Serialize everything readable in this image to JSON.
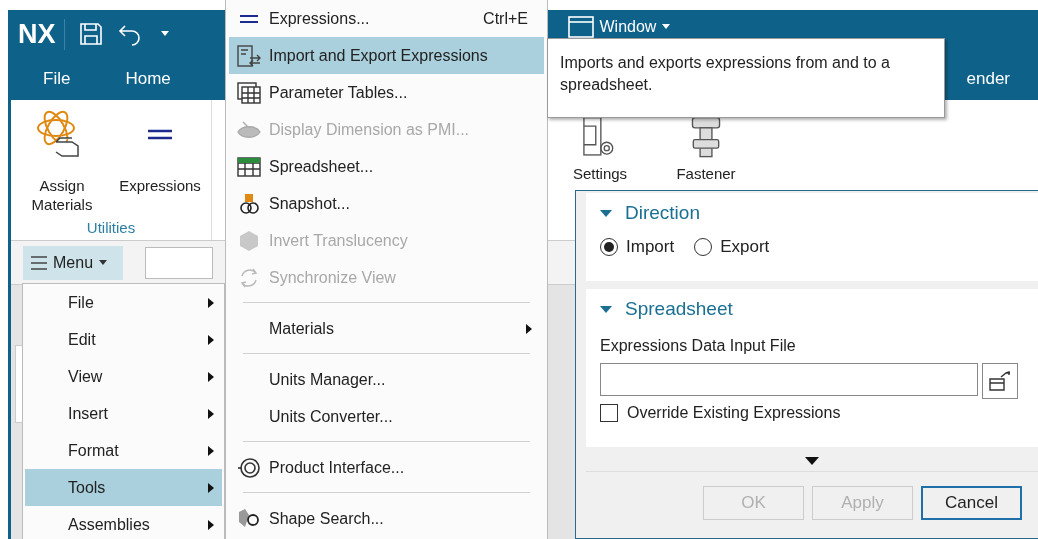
{
  "app": {
    "logo": "NX",
    "window_menu": "Window",
    "tabs": [
      {
        "label": "File"
      },
      {
        "label": "Home"
      },
      {
        "label": "ender"
      }
    ],
    "ribbon": {
      "commands": [
        {
          "label": "Assign Materials",
          "kind": "atom"
        },
        {
          "label": "Expressions",
          "kind": "equals"
        },
        {
          "label": "Settings",
          "kind": "settings"
        },
        {
          "label": "Fastener",
          "kind": "bolt"
        }
      ],
      "group_label": "Utilities"
    },
    "menu_button": "Menu"
  },
  "main_menu": {
    "items": [
      {
        "label": "File",
        "selected": false
      },
      {
        "label": "Edit",
        "selected": false
      },
      {
        "label": "View",
        "selected": false
      },
      {
        "label": "Insert",
        "selected": false
      },
      {
        "label": "Format",
        "selected": false
      },
      {
        "label": "Tools",
        "selected": true
      },
      {
        "label": "Assemblies",
        "selected": false
      }
    ]
  },
  "tools_menu": {
    "items": [
      {
        "kind": "item",
        "label": "Expressions...",
        "shortcut": "Ctrl+E",
        "selected": false,
        "disabled": false
      },
      {
        "kind": "item",
        "label": "Import and Export Expressions",
        "selected": true,
        "disabled": false
      },
      {
        "kind": "item",
        "label": "Parameter Tables...",
        "selected": false,
        "disabled": false
      },
      {
        "kind": "item",
        "label": "Display Dimension as PMI...",
        "selected": false,
        "disabled": true
      },
      {
        "kind": "item",
        "label": "Spreadsheet...",
        "selected": false,
        "disabled": false
      },
      {
        "kind": "item",
        "label": "Snapshot...",
        "selected": false,
        "disabled": false
      },
      {
        "kind": "item",
        "label": "Invert Translucency",
        "selected": false,
        "disabled": true
      },
      {
        "kind": "item",
        "label": "Synchronize View",
        "selected": false,
        "disabled": true
      },
      {
        "kind": "separator"
      },
      {
        "kind": "submenu",
        "label": "Materials",
        "selected": false,
        "disabled": false
      },
      {
        "kind": "separator"
      },
      {
        "kind": "item",
        "label": "Units Manager...",
        "selected": false,
        "disabled": false
      },
      {
        "kind": "item",
        "label": "Units Converter...",
        "selected": false,
        "disabled": false
      },
      {
        "kind": "separator"
      },
      {
        "kind": "item",
        "label": "Product Interface...",
        "selected": false,
        "disabled": false
      },
      {
        "kind": "separator"
      },
      {
        "kind": "item",
        "label": "Shape Search...",
        "selected": false,
        "disabled": false
      }
    ]
  },
  "tooltip": "Imports and exports expressions from and to a spreadsheet.",
  "dialog": {
    "sections": [
      {
        "title": "Direction",
        "expanded": true
      },
      {
        "title": "Spreadsheet",
        "expanded": true
      }
    ],
    "radios": [
      {
        "label": "Import",
        "selected": true
      },
      {
        "label": "Export",
        "selected": false
      }
    ],
    "field_label": "Expressions Data Input File",
    "checkbox": {
      "label": "Override Existing Expressions",
      "checked": false
    },
    "buttons": [
      {
        "label": "OK",
        "disabled": true
      },
      {
        "label": "Apply",
        "disabled": true
      },
      {
        "label": "Cancel",
        "disabled": false
      }
    ]
  }
}
